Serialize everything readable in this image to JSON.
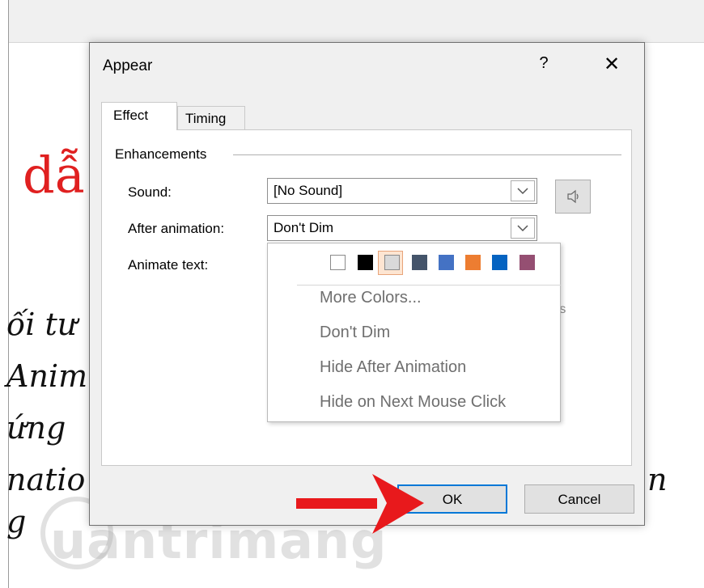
{
  "background": {
    "slide_title": "dẫ",
    "slide_lines": [
      "ối tư",
      "Anim",
      "ứng",
      "natio",
      "g"
    ],
    "slide_line_right": "n",
    "watermark": "uantrimang"
  },
  "dialog": {
    "title": "Appear",
    "help_label": "?",
    "close_label": "✕",
    "tabs": [
      {
        "label": "Effect",
        "active": true
      },
      {
        "label": "Timing",
        "active": false
      }
    ],
    "group_label": "Enhancements",
    "sound": {
      "label": "Sound:",
      "value": "[No Sound]"
    },
    "after_animation": {
      "label": "After animation:",
      "value": "Don't Dim"
    },
    "animate_text": {
      "label": "Animate text:"
    },
    "obscured_text": "rs",
    "dropdown": {
      "colors": [
        "#ffffff",
        "#000000",
        "#d9d9d9",
        "#44546a",
        "#4472c4",
        "#ed7d31",
        "#0563c1",
        "#954f72"
      ],
      "selected_color_index": 2,
      "items": [
        "More Colors...",
        "Don't Dim",
        "Hide After Animation",
        "Hide on Next Mouse Click"
      ]
    },
    "buttons": {
      "ok": "OK",
      "cancel": "Cancel"
    }
  },
  "colors": {
    "accent": "#0078d7",
    "arrow": "#e8191c",
    "slide_title": "#e02020"
  }
}
